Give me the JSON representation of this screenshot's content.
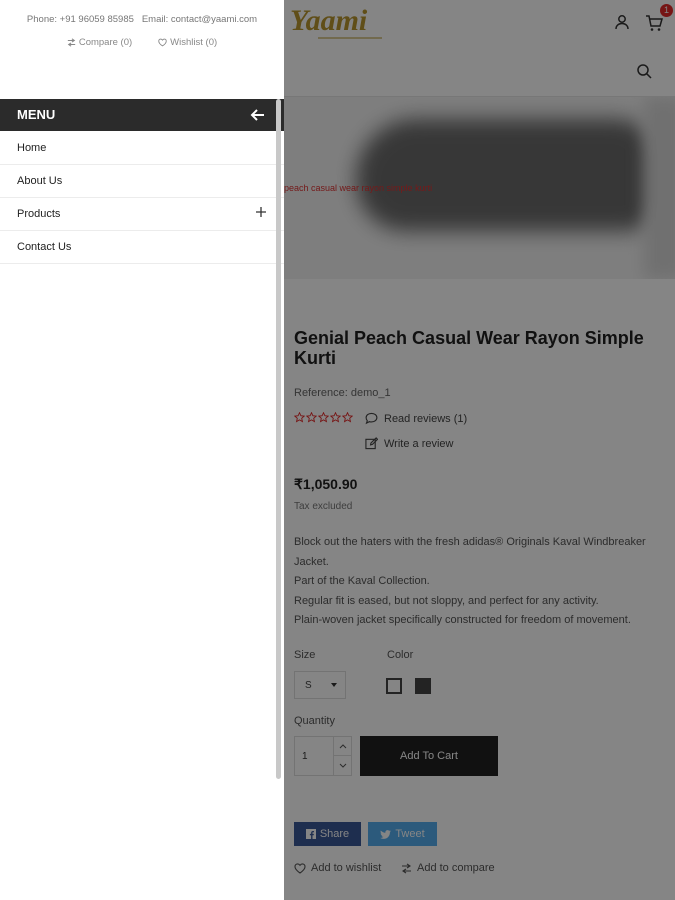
{
  "drawer": {
    "phone": "Phone: +91 96059 85985",
    "email": "Email: contact@yaami.com",
    "compare": "Compare (0)",
    "wishlist": "Wishlist (0)",
    "menu_title": "MENU",
    "items": [
      {
        "label": "Home"
      },
      {
        "label": "About Us"
      },
      {
        "label": "Products"
      },
      {
        "label": "Contact Us"
      }
    ]
  },
  "header": {
    "logo_text": "Yaami",
    "cart_count": "1"
  },
  "product": {
    "image_alt": "peach casual wear rayon simple kurti",
    "title": "Genial Peach Casual Wear Rayon Simple Kurti",
    "reference": "Reference: demo_1",
    "read_reviews": "Read reviews (1)",
    "write_review": "Write a review",
    "price": "₹1,050.90",
    "tax": "Tax excluded",
    "description": [
      "Block out the haters with the fresh adidas® Originals Kaval Windbreaker Jacket.",
      "Part of the Kaval Collection.",
      "Regular fit is eased, but not sloppy, and perfect for any activity.",
      "Plain-woven jacket specifically constructed for freedom of movement."
    ],
    "size_label": "Size",
    "size_value": "S",
    "color_label": "Color",
    "quantity_label": "Quantity",
    "quantity_value": "1",
    "add_to_cart": "Add To Cart",
    "share": "Share",
    "tweet": "Tweet",
    "add_wishlist": "Add to wishlist",
    "add_compare": "Add to compare"
  },
  "colors": {
    "accent_dark": "#222222",
    "menu_bar": "#2b2b2b",
    "share_bg": "#3b5998",
    "tweet_bg": "#55acee",
    "star": "#e32a2a",
    "badge": "#e32a2a"
  }
}
